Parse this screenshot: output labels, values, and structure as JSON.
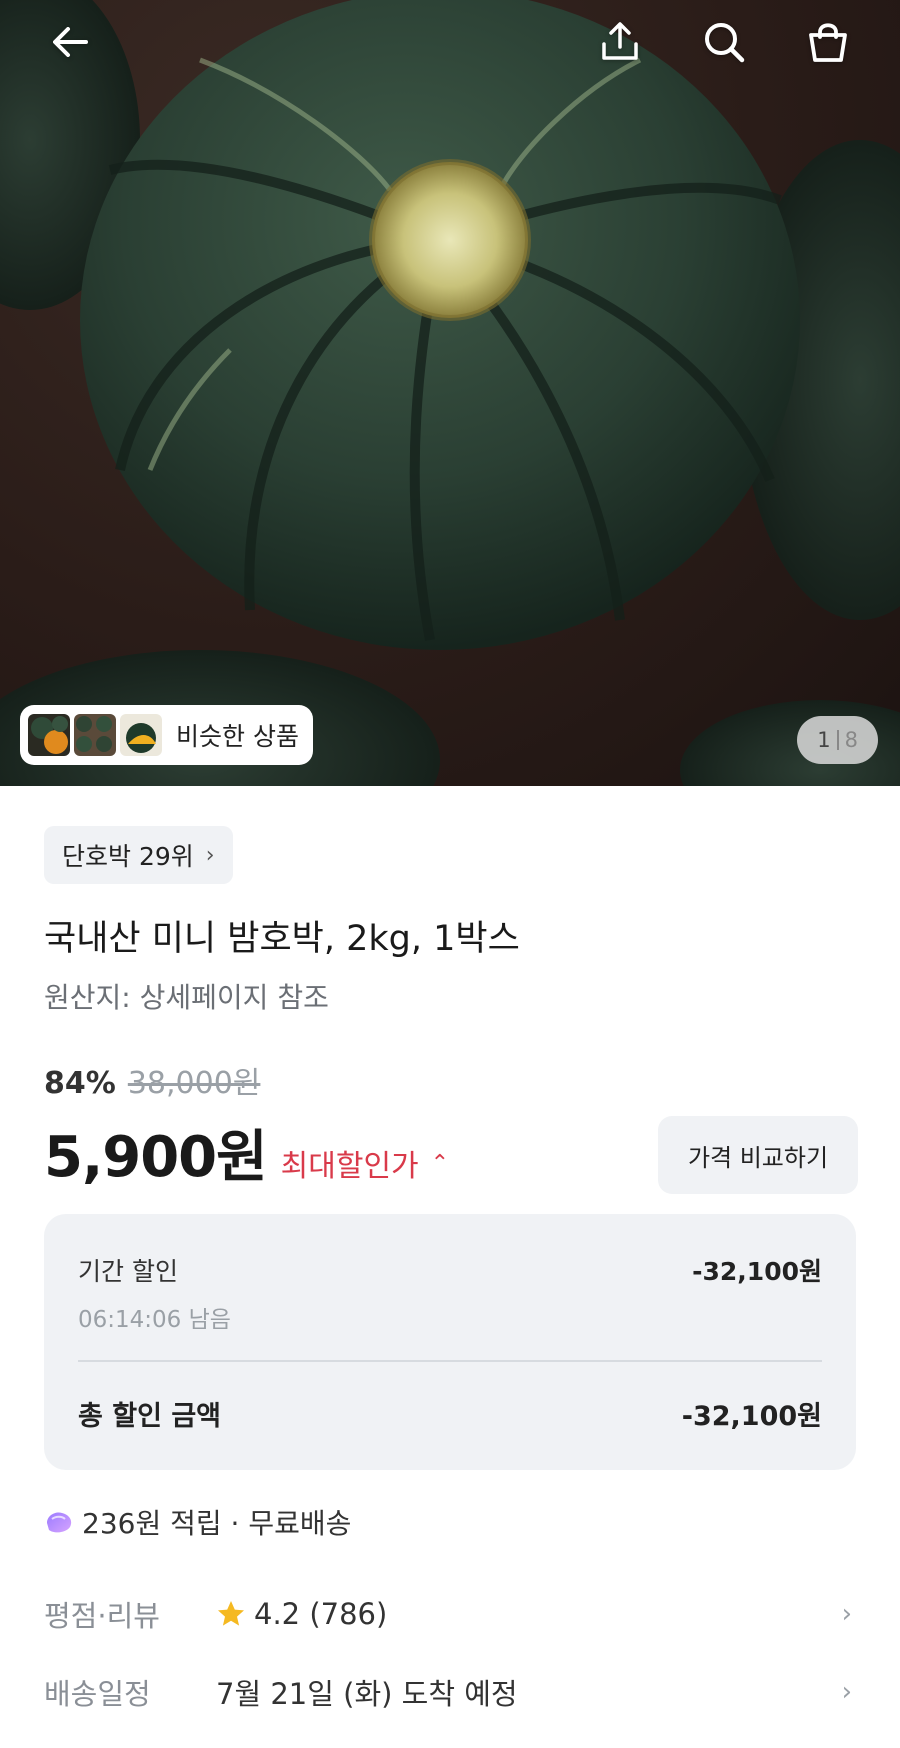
{
  "header": {
    "back_icon": "arrow-left-icon",
    "share_icon": "share-icon",
    "search_icon": "search-icon",
    "cart_icon": "shopping-bag-icon"
  },
  "gallery": {
    "similar_label": "비슷한 상품",
    "current_page": "1",
    "total_pages": "8"
  },
  "product": {
    "rank_label": "단호박 29위",
    "title": "국내산 미니 밤호박, 2kg, 1박스",
    "origin": "원산지: 상세페이지 참조",
    "discount_rate": "84%",
    "original_price": "38,000원",
    "price": "5,900원",
    "max_discount_label": "최대할인가",
    "compare_button": "가격 비교하기"
  },
  "discount_box": {
    "period_label": "기간 할인",
    "period_amount": "-32,100원",
    "timer": "06:14:06 남음",
    "total_label": "총 할인 금액",
    "total_amount": "-32,100원"
  },
  "benefits": {
    "text": "236원 적립 · 무료배송"
  },
  "info": {
    "rating_label": "평점·리뷰",
    "rating_value": "4.2 (786)",
    "delivery_label": "배송일정",
    "delivery_value": "7월 21일 (화) 도착 예정"
  },
  "colors": {
    "accent_red": "#d93a4a",
    "star_yellow": "#f5b921",
    "panel_gray": "#f0f2f5"
  }
}
